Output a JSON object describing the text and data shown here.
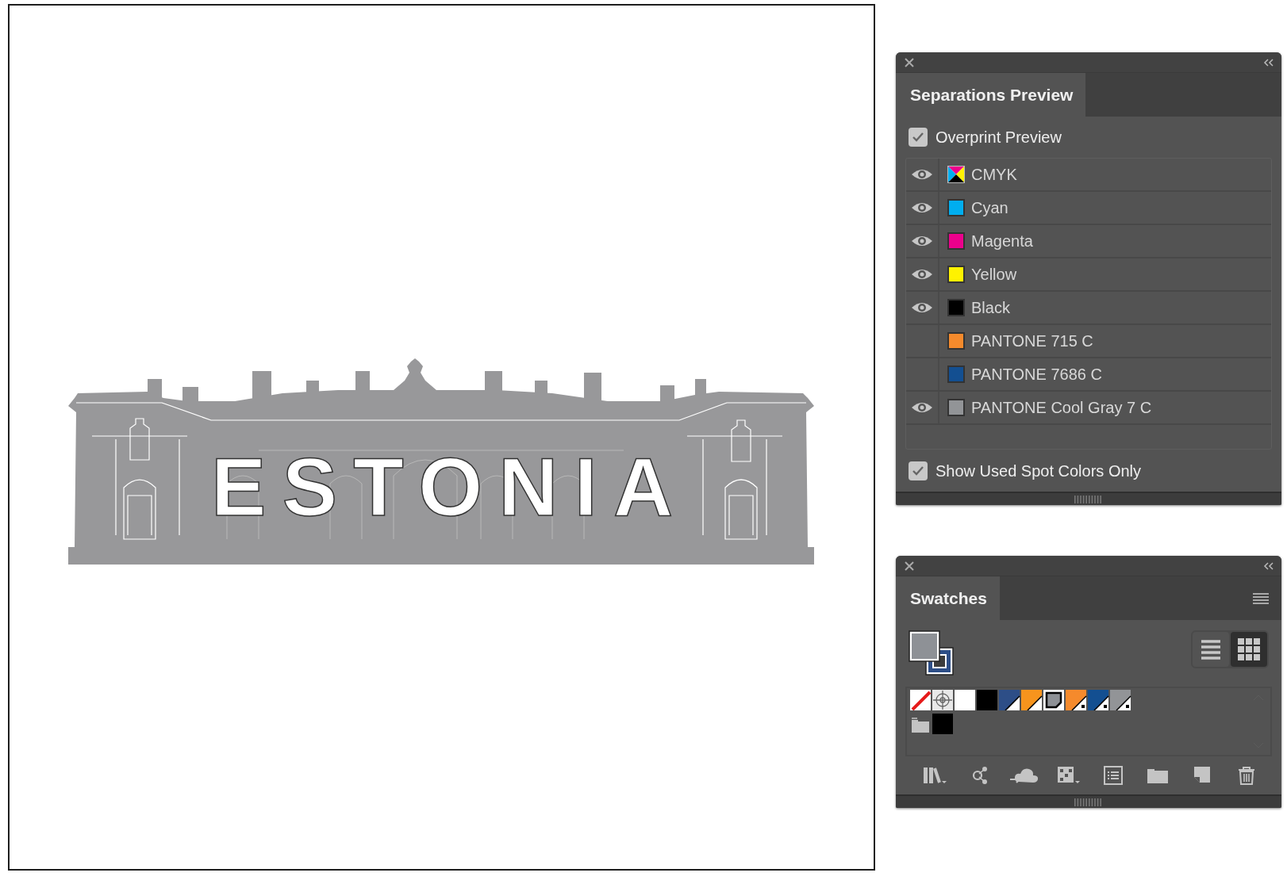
{
  "artwork": {
    "text": "ESTONIA"
  },
  "separations": {
    "title": "Separations Preview",
    "overprint": {
      "label": "Overprint Preview",
      "checked": true
    },
    "inks": [
      {
        "name": "CMYK",
        "visible": true,
        "kind": "composite"
      },
      {
        "name": "Cyan",
        "visible": true,
        "kind": "plate",
        "color": "#00aeef"
      },
      {
        "name": "Magenta",
        "visible": true,
        "kind": "plate",
        "color": "#ec008c"
      },
      {
        "name": "Yellow",
        "visible": true,
        "kind": "plate",
        "color": "#fff200"
      },
      {
        "name": "Black",
        "visible": true,
        "kind": "plate",
        "color": "#000000"
      },
      {
        "name": "PANTONE 715 C",
        "visible": false,
        "kind": "plate",
        "color": "#f58a2c"
      },
      {
        "name": "PANTONE 7686 C",
        "visible": false,
        "kind": "plate",
        "color": "#134f91"
      },
      {
        "name": "PANTONE Cool Gray 7 C",
        "visible": true,
        "kind": "plate",
        "color": "#929497"
      }
    ],
    "spot_only": {
      "label": "Show Used Spot Colors Only",
      "checked": true
    }
  },
  "swatches": {
    "title": "Swatches",
    "views": [
      {
        "kind": "list",
        "selected": false
      },
      {
        "kind": "grid",
        "selected": true
      }
    ],
    "rows": [
      [
        {
          "kind": "none",
          "selected": false
        },
        {
          "kind": "registration",
          "selected": false
        },
        {
          "kind": "process",
          "color": "#ffffff",
          "selected": false
        },
        {
          "kind": "process",
          "color": "#000000",
          "selected": false
        },
        {
          "kind": "global",
          "color": "#2d4e87",
          "selected": false
        },
        {
          "kind": "global",
          "color": "#f7941d",
          "selected": false
        },
        {
          "kind": "global",
          "color": "#8e9196",
          "selected": true
        },
        {
          "kind": "spot",
          "color": "#f58a2c",
          "selected": false
        },
        {
          "kind": "spot",
          "color": "#134f91",
          "selected": false
        },
        {
          "kind": "spot",
          "color": "#929497",
          "selected": false
        }
      ],
      [
        {
          "kind": "group",
          "selected": false
        },
        {
          "kind": "process",
          "color": "#000000",
          "selected": false
        }
      ]
    ]
  }
}
